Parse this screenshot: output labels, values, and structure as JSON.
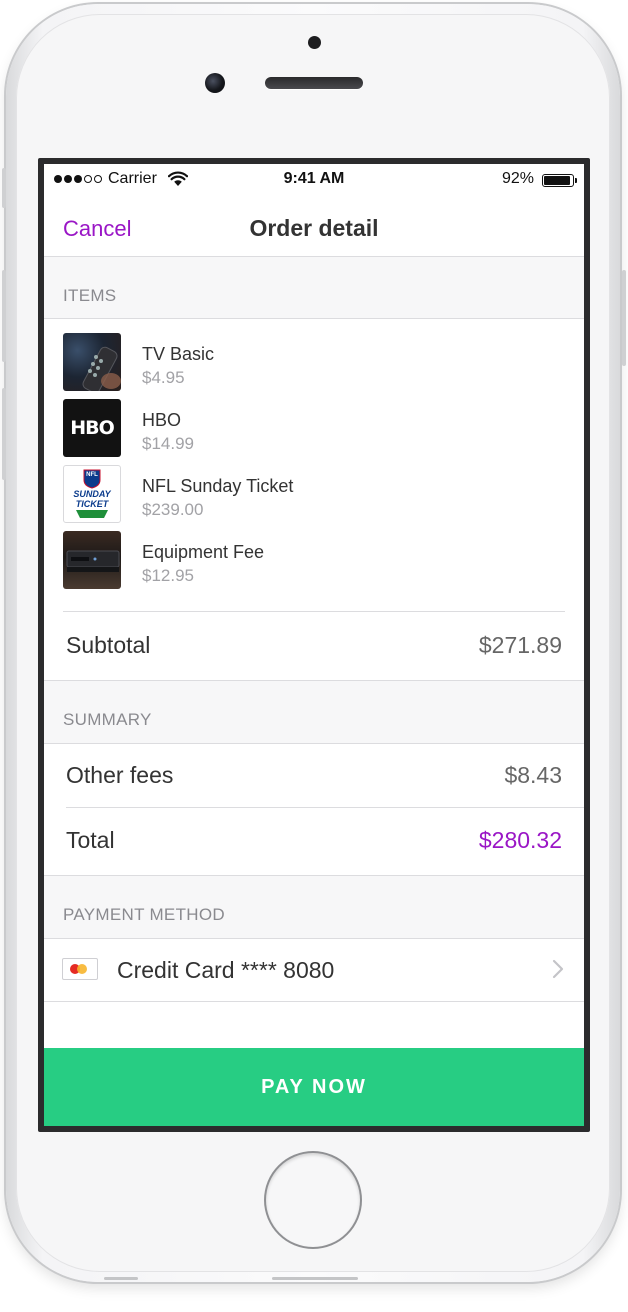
{
  "status_bar": {
    "carrier": "Carrier",
    "time": "9:41 AM",
    "battery": "92%",
    "signal_bars": 3,
    "signal_total": 5
  },
  "nav": {
    "cancel_label": "Cancel",
    "title": "Order detail"
  },
  "items_section": {
    "header": "ITEMS",
    "items": [
      {
        "name": "TV Basic",
        "price": "$4.95",
        "thumb": "tv-remote-thumbnail"
      },
      {
        "name": "HBO",
        "price": "$14.99",
        "thumb": "hbo-logo"
      },
      {
        "name": "NFL Sunday Ticket",
        "price": "$239.00",
        "thumb": "nfl-sunday-ticket-logo"
      },
      {
        "name": "Equipment Fee",
        "price": "$12.95",
        "thumb": "set-top-box-thumbnail"
      }
    ],
    "subtotal_label": "Subtotal",
    "subtotal_value": "$271.89"
  },
  "summary_section": {
    "header": "SUMMARY",
    "other_fees_label": "Other fees",
    "other_fees_value": "$8.43",
    "total_label": "Total",
    "total_value": "$280.32"
  },
  "payment_section": {
    "header": "PAYMENT METHOD",
    "method_label": "Credit Card **** 8080",
    "icon": "mastercard-icon"
  },
  "pay_button": {
    "label": "PAY NOW"
  },
  "thumb_text": {
    "hbo": "HBO",
    "nfl_top": "NFL",
    "nfl_line1": "SUNDAY",
    "nfl_line2": "TICKET"
  },
  "colors": {
    "accent_purple": "#9a16c6",
    "pay_green": "#27cd83",
    "section_bg": "#f7f7f8",
    "secondary_text": "#a2a2a6"
  }
}
